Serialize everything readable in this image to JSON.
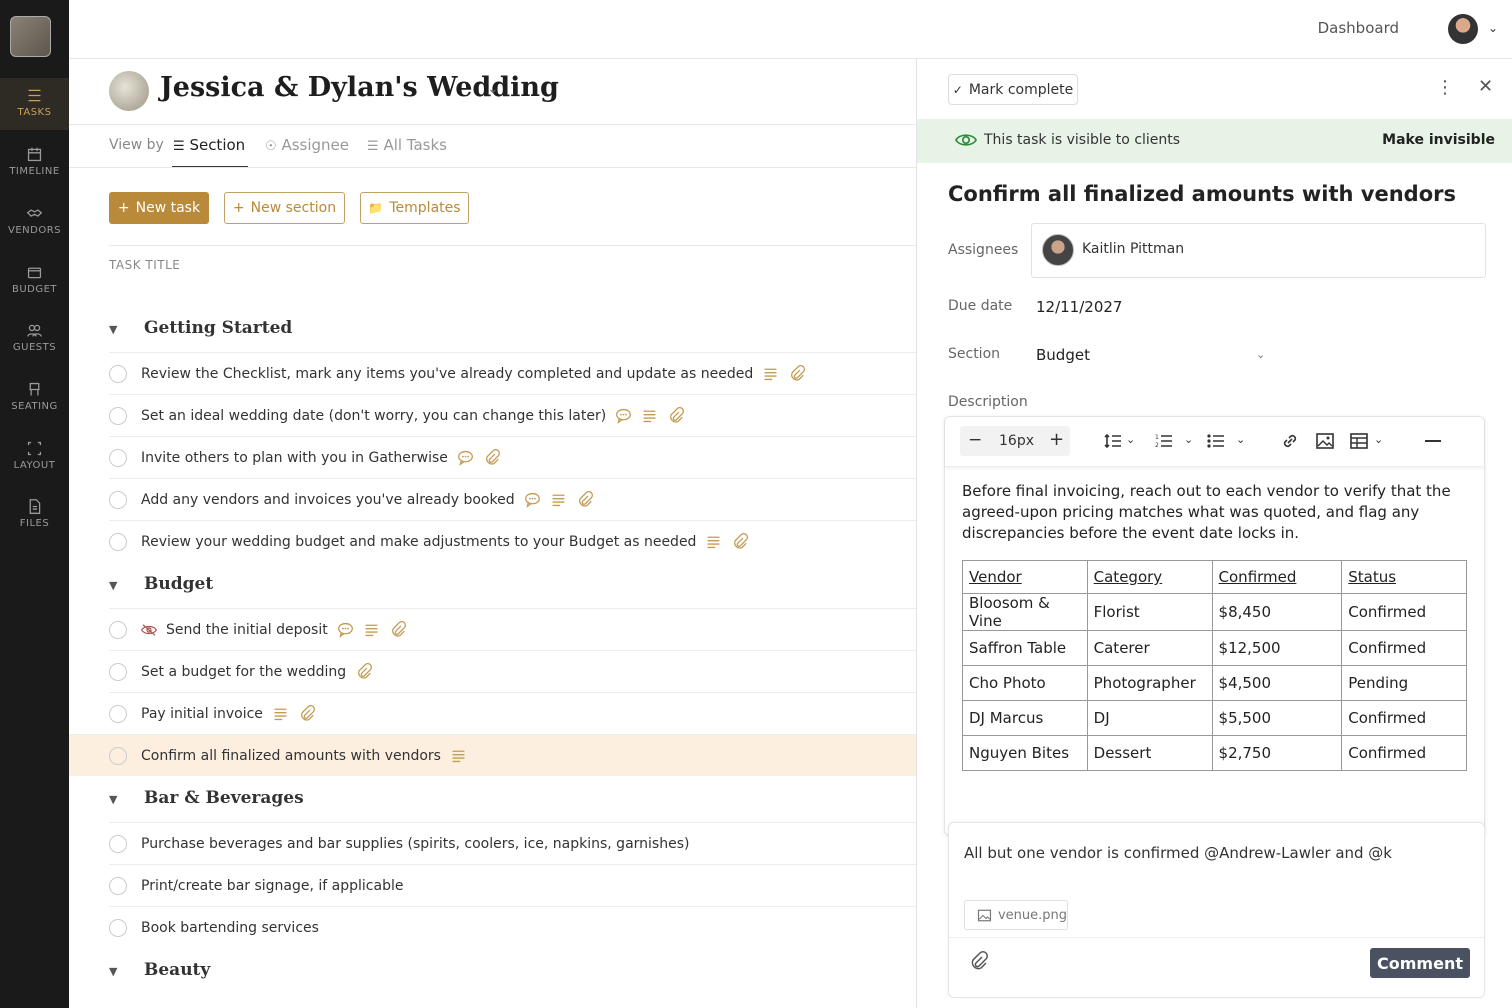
{
  "nav": {
    "items": [
      {
        "label": "TASKS",
        "icon": "tasks-icon"
      },
      {
        "label": "TIMELINE",
        "icon": "calendar-icon"
      },
      {
        "label": "VENDORS",
        "icon": "handshake-icon"
      },
      {
        "label": "BUDGET",
        "icon": "wallet-icon"
      },
      {
        "label": "GUESTS",
        "icon": "people-icon"
      },
      {
        "label": "SEATING",
        "icon": "chair-icon"
      },
      {
        "label": "LAYOUT",
        "icon": "layout-icon"
      },
      {
        "label": "FILES",
        "icon": "file-icon"
      }
    ],
    "active": "TASKS"
  },
  "topbar": {
    "dashboard_label": "Dashboard"
  },
  "project": {
    "title": "Jessica & Dylan's Wedding"
  },
  "viewby": {
    "label": "View by",
    "tabs": [
      {
        "label": "Section"
      },
      {
        "label": "Assignee"
      },
      {
        "label": "All Tasks"
      }
    ],
    "active": "Section"
  },
  "actions": {
    "new_task": "New task",
    "new_section": "New section",
    "templates": "Templates"
  },
  "list": {
    "column_header": "TASK TITLE"
  },
  "sections": [
    {
      "title": "Getting Started",
      "tasks": [
        {
          "title": "Review the Checklist, mark any items you've already completed and update as needed",
          "icons": [
            "description",
            "attachment"
          ]
        },
        {
          "title": "Set an ideal wedding date (don't worry, you can change this later)",
          "icons": [
            "comment",
            "description",
            "attachment"
          ]
        },
        {
          "title": "Invite others to plan with you in Gatherwise",
          "icons": [
            "comment",
            "attachment"
          ]
        },
        {
          "title": "Add any vendors and invoices you've already booked",
          "icons": [
            "comment",
            "description",
            "attachment"
          ]
        },
        {
          "title": "Review your wedding budget and make adjustments to your Budget as needed",
          "icons": [
            "description",
            "attachment"
          ]
        }
      ]
    },
    {
      "title": "Budget",
      "tasks": [
        {
          "title": "Send the initial deposit",
          "hidden": true,
          "icons": [
            "comment",
            "description",
            "attachment"
          ]
        },
        {
          "title": "Set a budget for the wedding",
          "icons": [
            "attachment"
          ]
        },
        {
          "title": "Pay initial invoice",
          "icons": [
            "description",
            "attachment"
          ]
        },
        {
          "title": "Confirm all finalized amounts with vendors",
          "selected": true,
          "icons": [
            "description"
          ]
        }
      ]
    },
    {
      "title": "Bar & Beverages",
      "tasks": [
        {
          "title": "Purchase beverages and bar supplies (spirits, coolers, ice, napkins, garnishes)",
          "icons": []
        },
        {
          "title": "Print/create bar signage, if applicable",
          "icons": []
        },
        {
          "title": "Book bartending services",
          "icons": []
        }
      ]
    },
    {
      "title": "Beauty",
      "tasks": []
    }
  ],
  "detail": {
    "mark_complete": "Mark complete",
    "visibility_text": "This task is visible to clients",
    "make_invisible": "Make invisible",
    "title": "Confirm all finalized amounts with vendors",
    "assignees_label": "Assignees",
    "assignee_name": "Kaitlin Pittman",
    "due_label": "Due date",
    "due_value": "12/11/2027",
    "section_label": "Section",
    "section_value": "Budget",
    "description_label": "Description",
    "font_size": "16px",
    "description_text": "Before final invoicing, reach out to each vendor to verify that the agreed-upon pricing matches what was quoted, and flag any discrepancies before the event date locks in.",
    "table": {
      "headers": [
        "Vendor",
        "Category",
        "Confirmed",
        "Status"
      ],
      "rows": [
        [
          "Bloosom & Vine",
          "Florist",
          "$8,450",
          "Confirmed"
        ],
        [
          "Saffron Table",
          "Caterer",
          "$12,500",
          "Confirmed"
        ],
        [
          "Cho Photo",
          "Photographer",
          "$4,500",
          "Pending"
        ],
        [
          "DJ Marcus",
          "DJ",
          "$5,500",
          "Confirmed"
        ],
        [
          "Nguyen Bites",
          "Dessert",
          "$2,750",
          "Confirmed"
        ]
      ]
    },
    "comment_text": "All but one vendor is confirmed @Andrew-Lawler and @k",
    "attachment_name": "venue.png",
    "comment_button": "Comment"
  },
  "colors": {
    "accent": "#b88a3a",
    "sidebar": "#1a1a1a",
    "visible_bar": "#e6f3e6",
    "selected_row": "#fcefe0",
    "comment_button": "#4a5160"
  }
}
